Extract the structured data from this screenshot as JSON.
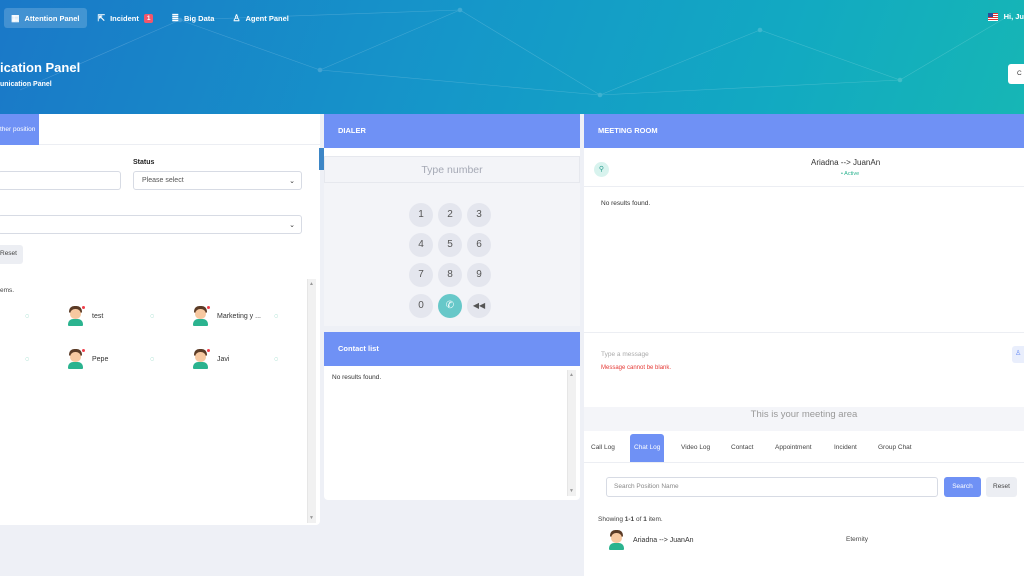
{
  "nav": {
    "items": [
      {
        "label": "Attention Panel",
        "icon": "calendar-icon",
        "active": true
      },
      {
        "label": "Incident",
        "icon": "share-icon",
        "badge": "1"
      },
      {
        "label": "Big Data",
        "icon": "database-icon"
      },
      {
        "label": "Agent Panel",
        "icon": "agent-icon"
      }
    ],
    "greeting": "Hi, Ju"
  },
  "header": {
    "title": "ication Panel",
    "subtitle": "unication Panel",
    "corner_button": "C"
  },
  "left_panel": {
    "tab_label": "ther position",
    "status_label": "Status",
    "status_placeholder": "Please select",
    "reset_label": "Reset",
    "items_text": "ems.",
    "people": [
      {
        "name": "test"
      },
      {
        "name": "Marketing y ..."
      },
      {
        "name": "Pepe"
      },
      {
        "name": "Javi"
      }
    ]
  },
  "dialer": {
    "title": "DIALER",
    "placeholder": "Type number",
    "keys": [
      "1",
      "2",
      "3",
      "4",
      "5",
      "6",
      "7",
      "8",
      "9",
      "0"
    ]
  },
  "contacts": {
    "title": "Contact list",
    "empty": "No results found."
  },
  "meeting": {
    "title": "MEETING ROOM",
    "user": "Ariadna --> JuanAn",
    "status": "• Active",
    "empty": "No results found.",
    "message_placeholder": "Type a message",
    "message_error": "Message cannot be blank.",
    "area_text": "This is your meeting area",
    "tabs": [
      "Call Log",
      "Chat Log",
      "Video Log",
      "Contact",
      "Appointment",
      "Incident",
      "Group Chat"
    ],
    "active_tab": "Chat Log",
    "search_placeholder": "Search Position Name",
    "search_button": "Search",
    "reset_button": "Reset",
    "showing_prefix": "Showing ",
    "showing_range": "1-1",
    "showing_mid": " of ",
    "showing_total": "1",
    "showing_suffix": " item.",
    "row": {
      "name": "Ariadna --> JuanAn",
      "value": "Eternity"
    }
  },
  "colors": {
    "accent": "#6f91f5",
    "teal": "#67c8c9",
    "error": "#e53935",
    "status_active": "#2bb38f"
  }
}
